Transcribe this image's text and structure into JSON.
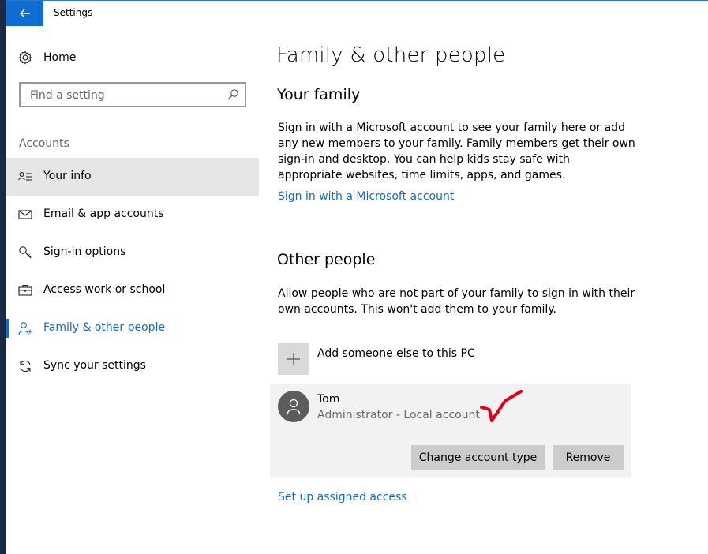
{
  "window": {
    "title": "Settings"
  },
  "sidebar": {
    "home_label": "Home",
    "search_placeholder": "Find a setting",
    "section_heading": "Accounts",
    "items": [
      {
        "label": "Your info",
        "icon": "person-card-icon"
      },
      {
        "label": "Email & app accounts",
        "icon": "envelope-icon"
      },
      {
        "label": "Sign-in options",
        "icon": "key-icon"
      },
      {
        "label": "Access work or school",
        "icon": "briefcase-icon"
      },
      {
        "label": "Family & other people",
        "icon": "person-add-icon"
      },
      {
        "label": "Sync your settings",
        "icon": "sync-icon"
      }
    ],
    "hovered_item": "Your info",
    "current_item": "Family & other people"
  },
  "main": {
    "page_title": "Family & other people",
    "family": {
      "heading": "Your family",
      "description": "Sign in with a Microsoft account to see your family here or add any new members to your family. Family members get their own sign-in and desktop. You can help kids stay safe with appropriate websites, time limits, apps, and games.",
      "link": "Sign in with a Microsoft account"
    },
    "other": {
      "heading": "Other people",
      "description": "Allow people who are not part of your family to sign in with their own accounts. This won't add them to your family.",
      "add_label": "Add someone else to this PC",
      "user": {
        "name": "Tom",
        "role": "Administrator - Local account",
        "change_button": "Change account type",
        "remove_button": "Remove"
      },
      "assigned_access_link": "Set up assigned access"
    }
  },
  "colors": {
    "accent": "#0f6cd1",
    "selected_bg": "#e6e6e6",
    "card_bg": "#f2f2f2",
    "button_bg": "#cccccc",
    "annotation_check": "#e0001b"
  }
}
